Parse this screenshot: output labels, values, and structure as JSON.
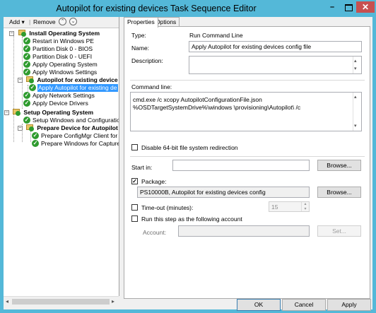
{
  "window": {
    "title": "Autopilot for existing devices Task Sequence Editor",
    "min_glyph": "–",
    "close_glyph": "✕"
  },
  "toolbar": {
    "add_label": "Add",
    "add_arrow": "▾",
    "separator": "|",
    "remove_label": "Remove",
    "up_glyph": "⌃",
    "down_glyph": "⌄"
  },
  "tree": {
    "groups": [
      {
        "label": "Install Operating System",
        "expanded": "−"
      },
      {
        "label": "Autopilot for existing device",
        "expanded": "−"
      },
      {
        "label": "Setup Operating System",
        "expanded": "−"
      },
      {
        "label": "Prepare Device for Autopilot",
        "expanded": "−"
      }
    ],
    "steps": [
      "Restart in Windows PE",
      "Partition Disk 0 - BIOS",
      "Partition Disk 0 - UEFI",
      "Apply Operating System",
      "Apply Windows Settings",
      "Apply Autopilot for existing de",
      "Apply Network Settings",
      "Apply Device Drivers",
      "Setup Windows and Configuration",
      "Prepare ConfigMgr Client for C",
      "Prepare Windows for Capture"
    ],
    "check_glyph": "✓",
    "selected_step": "Apply Autopilot for existing de"
  },
  "tabs": [
    "Properties",
    "Options"
  ],
  "properties": {
    "type_label": "Type:",
    "type_value": "Run Command Line",
    "name_label": "Name:",
    "name_value": "Apply Autopilot for existing devices config file",
    "description_label": "Description:",
    "description_value": "",
    "command_line_label": "Command line:",
    "command_line_value": "cmd.exe /c xcopy AutopilotConfigurationFile.json %OSDTargetSystemDrive%\\windows \\provisioning\\Autopilot\\ /c",
    "disable_redirection_label": "Disable 64-bit file system redirection",
    "disable_redirection_checked": "",
    "start_in_label": "Start in:",
    "start_in_value": "",
    "browse_label": "Browse...",
    "package_label": "Package:",
    "package_checked": "✓",
    "package_value": "PS10000B, Autopilot for existing devices config",
    "timeout_label": "Time-out (minutes):",
    "timeout_checked": "",
    "timeout_value": "15",
    "run_as_label": "Run this step as the following account",
    "run_as_checked": "",
    "account_label": "Account:",
    "account_value": "",
    "set_label": "Set..."
  },
  "footer": {
    "ok_label": "OK",
    "cancel_label": "Cancel",
    "apply_label": "Apply"
  }
}
